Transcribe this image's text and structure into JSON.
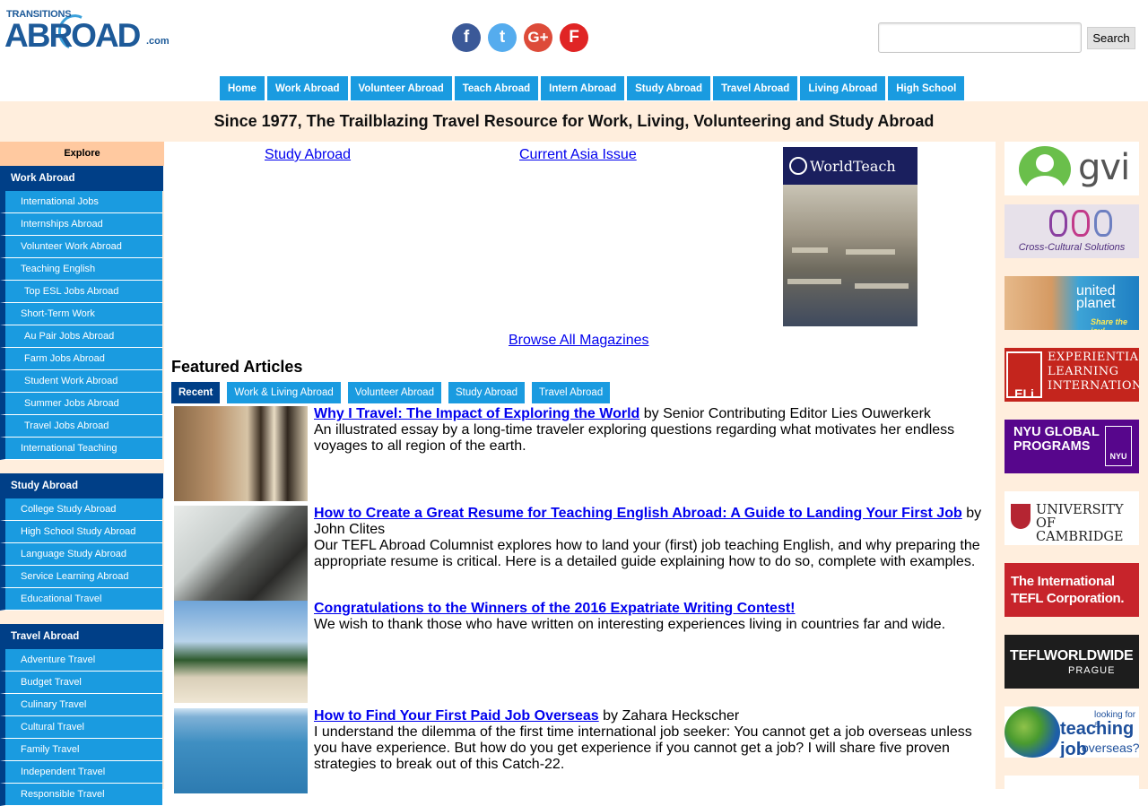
{
  "logo": {
    "top": "TRANSITIONS",
    "main": "ABROAD",
    "suffix": ".com"
  },
  "social": [
    {
      "name": "facebook",
      "glyph": "f"
    },
    {
      "name": "twitter",
      "glyph": "t"
    },
    {
      "name": "google-plus",
      "glyph": "G+"
    },
    {
      "name": "flipboard",
      "glyph": "F"
    }
  ],
  "search": {
    "placeholder": "",
    "button": "Search"
  },
  "nav": [
    "Home",
    "Work Abroad",
    "Volunteer Abroad",
    "Teach Abroad",
    "Intern Abroad",
    "Study Abroad",
    "Travel Abroad",
    "Living Abroad",
    "High School"
  ],
  "tagline": "Since 1977, The Trailblazing Travel Resource for Work, Living, Volunteering and Study Abroad",
  "sidebar": {
    "explore": "Explore",
    "sections": [
      {
        "title": "Work Abroad",
        "items": [
          "International Jobs",
          "Internships Abroad",
          "Volunteer Work Abroad",
          "Teaching English",
          "Top ESL Jobs Abroad",
          "Short-Term Work",
          "Au Pair Jobs Abroad",
          "Farm Jobs Abroad",
          "Student Work Abroad",
          "Summer Jobs Abroad",
          "Travel Jobs Abroad",
          "International Teaching"
        ]
      },
      {
        "title": "Study Abroad",
        "items": [
          "College Study Abroad",
          "High School Study Abroad",
          "Language Study Abroad",
          "Service Learning Abroad",
          "Educational Travel"
        ]
      },
      {
        "title": "Travel Abroad",
        "items": [
          "Adventure Travel",
          "Budget Travel",
          "Culinary Travel",
          "Cultural Travel",
          "Family Travel",
          "Independent Travel",
          "Responsible Travel"
        ]
      }
    ]
  },
  "magazines": {
    "study": "Study Abroad",
    "asia": "Current Asia Issue",
    "browse": "Browse All Magazines",
    "ad_title": "WorldTeach"
  },
  "featured": {
    "title": "Featured Articles",
    "tabs": [
      "Recent",
      "Work & Living Abroad",
      "Volunteer Abroad",
      "Study Abroad",
      "Travel Abroad"
    ],
    "articles": [
      {
        "title": "Why I Travel: The Impact of Exploring the World",
        "byline": " by Senior Contributing Editor Lies Ouwerkerk",
        "desc": "An illustrated essay by a long-time traveler exploring questions regarding what motivates her endless voyages to all region of the earth."
      },
      {
        "title": "How to Create a Great Resume for Teaching English Abroad: A Guide to Landing Your First Job",
        "byline": " by John Clites",
        "desc": "Our TEFL Abroad Columnist explores how to land your (first) job teaching English, and why preparing the appropriate resume is critical. Here is a detailed guide explaining how to do so, complete with examples."
      },
      {
        "title": "Congratulations to the Winners of the 2016 Expatriate Writing Contest!",
        "byline": "",
        "desc": "We wish to thank those who have written on interesting experiences living in countries far and wide."
      },
      {
        "title": "How to Find Your First Paid Job Overseas",
        "byline": " by Zahara Heckscher",
        "desc": "I understand the dilemma of the first time international job seeker: You cannot get a job overseas unless you have experience. But how do you get experience if you cannot get a job? I will share five proven strategies to break out of this Catch-22."
      }
    ]
  },
  "ads": {
    "gvi": "gvi",
    "ccs": "Cross-Cultural Solutions",
    "united_planet": "united planet",
    "united_planet_tag": "Share the joy!",
    "eli_logo": "ELi",
    "eli": "EXPERIENTIAL LEARNING INTERNATIONAL",
    "nyu": "NYU GLOBAL PROGRAMS",
    "nyu_box": "NYU",
    "cambridge": "UNIVERSITY OF CAMBRIDGE",
    "tefl_corp": "The International TEFL Corporation.",
    "tefl_ww": "TEFLWORLDWIDE",
    "tefl_ww_sub": "PRAGUE",
    "teaching_l1": "looking for a",
    "teaching_l2": "teaching job",
    "teaching_l3": "overseas?"
  }
}
